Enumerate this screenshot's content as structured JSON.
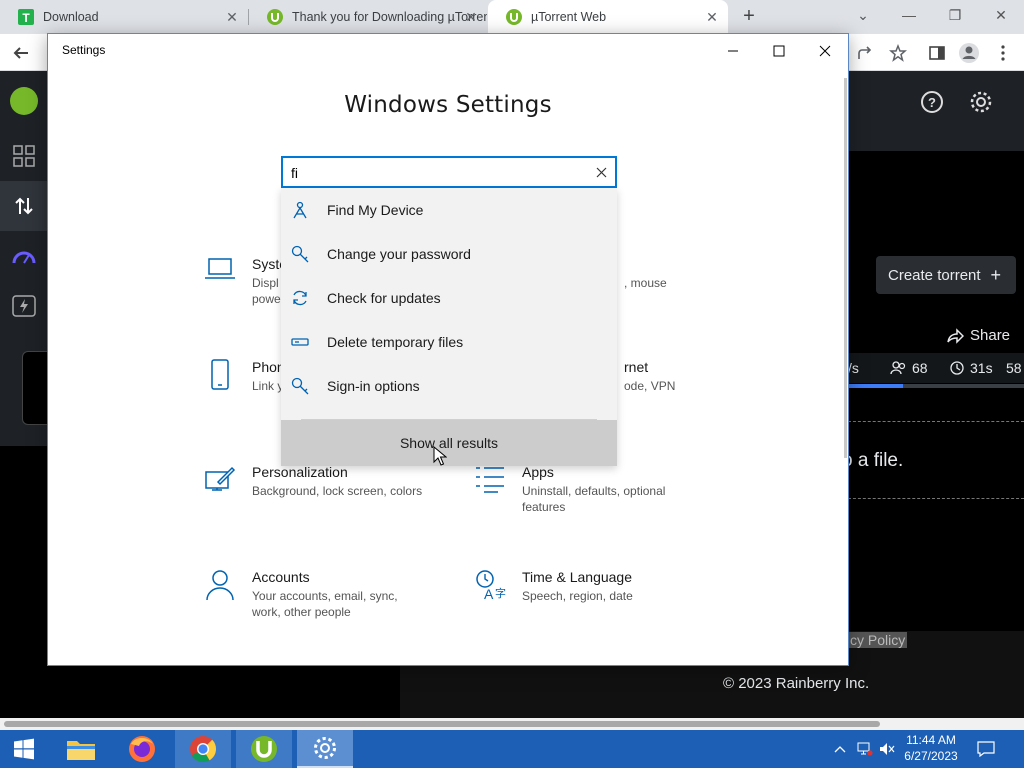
{
  "browser": {
    "tabs": [
      {
        "label": "Download",
        "favicon": "T",
        "favicon_color": "#22b14c"
      },
      {
        "label": "Thank you for Downloading µTorrent",
        "favicon": "µ",
        "favicon_color": "#76b82a"
      },
      {
        "label": "µTorrent Web",
        "favicon": "µ",
        "favicon_color": "#76b82a"
      }
    ],
    "new_tab_symbol": "+"
  },
  "utorrent_page": {
    "create_torrent_label": "Create torrent",
    "share_label": "Share",
    "stats": {
      "speed": "/s",
      "peers": "68",
      "time": "31s",
      "extra": "58"
    },
    "progress_fraction": 0.31,
    "drop_text": "o a file.",
    "policy_text": "cy Policy",
    "copyright": "© 2023 Rainberry Inc."
  },
  "settings": {
    "window_title": "Settings",
    "heading": "Windows Settings",
    "search_value": "fi",
    "suggestions": [
      {
        "label": "Find My Device",
        "icon": "find-device-icon"
      },
      {
        "label": "Change your password",
        "icon": "key-icon"
      },
      {
        "label": "Check for updates",
        "icon": "sync-icon"
      },
      {
        "label": "Delete temporary files",
        "icon": "storage-icon"
      },
      {
        "label": "Sign-in options",
        "icon": "key-icon"
      }
    ],
    "show_all_label": "Show all results",
    "categories": {
      "system": {
        "name": "Syste",
        "desc_line1": "Displ",
        "desc_line2": "powe"
      },
      "devices": {
        "desc": ", mouse"
      },
      "phone": {
        "name": "Phon",
        "desc": "Link y"
      },
      "network": {
        "name": "rnet",
        "desc": "ode, VPN"
      },
      "personalization": {
        "name": "Personalization",
        "desc": "Background, lock screen, colors"
      },
      "apps": {
        "name": "Apps",
        "desc": "Uninstall, defaults, optional features"
      },
      "accounts": {
        "name": "Accounts",
        "desc": "Your accounts, email, sync, work, other people"
      },
      "time_language": {
        "name": "Time & Language",
        "desc": "Speech, region, date"
      }
    },
    "accent_color": "#0078d7"
  },
  "taskbar": {
    "time": "11:44 AM",
    "date": "6/27/2023",
    "color": "#1c5fb5"
  }
}
